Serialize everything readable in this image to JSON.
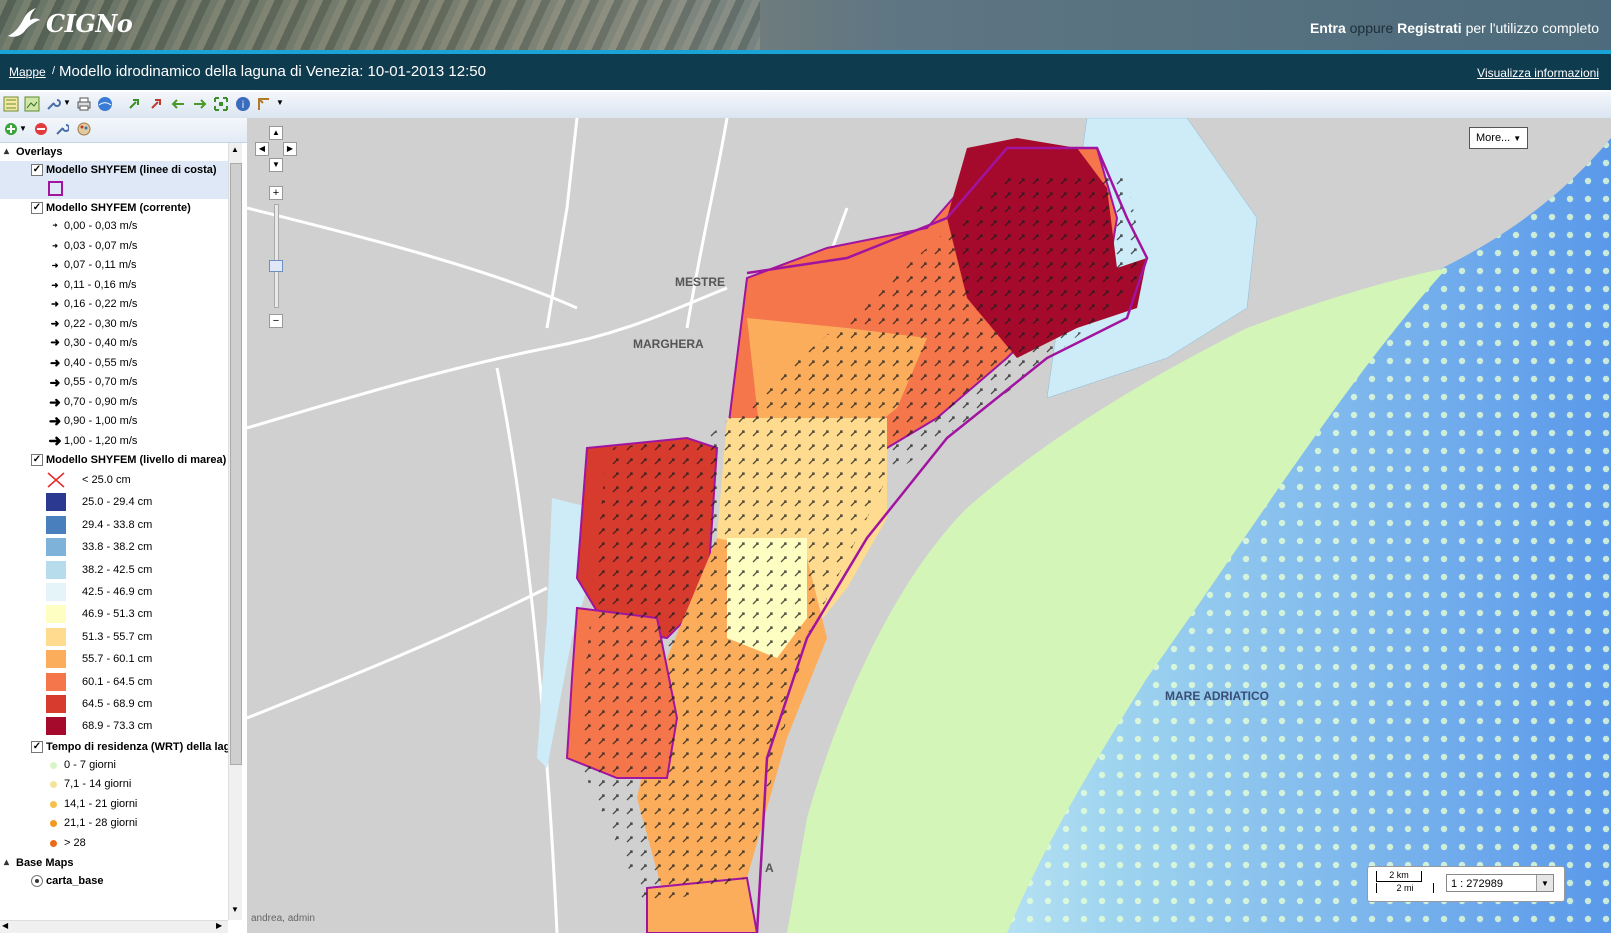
{
  "header": {
    "logo_text": "CIGNo",
    "login_label": "Entra",
    "or_label": "oppure",
    "register_label": "Registrati",
    "suffix": "per l'utilizzo completo"
  },
  "titlebar": {
    "breadcrumb": "Mappe",
    "separator": "/",
    "title": "Modello idrodinamico della laguna di Venezia: 10-01-2013 12:50",
    "info_link": "Visualizza informazioni"
  },
  "tree": {
    "overlays_label": "Overlays",
    "layer_coast": "Modello SHYFEM (linee di costa)",
    "layer_current": "Modello SHYFEM (corrente)",
    "current_classes": [
      "0,00 - 0,03 m/s",
      "0,03 - 0,07 m/s",
      "0,07 - 0,11 m/s",
      "0,11 - 0,16 m/s",
      "0,16 - 0,22 m/s",
      "0,22 - 0,30 m/s",
      "0,30 - 0,40 m/s",
      "0,40 - 0,55 m/s",
      "0,55 - 0,70 m/s",
      "0,70 - 0,90 m/s",
      "0,90 - 1,00 m/s",
      "1,00 - 1,20 m/s"
    ],
    "layer_tide": "Modello SHYFEM (livello di marea)",
    "tide_classes": [
      {
        "label": "< 25.0 cm",
        "color": "none"
      },
      {
        "label": "25.0 - 29.4 cm",
        "color": "#2b3990"
      },
      {
        "label": "29.4 - 33.8 cm",
        "color": "#4a7fbd"
      },
      {
        "label": "33.8 - 38.2 cm",
        "color": "#7fb2d9"
      },
      {
        "label": "38.2 - 42.5 cm",
        "color": "#b7dcec"
      },
      {
        "label": "42.5 - 46.9 cm",
        "color": "#e4f4f8"
      },
      {
        "label": "46.9 - 51.3 cm",
        "color": "#fffec2"
      },
      {
        "label": "51.3 - 55.7 cm",
        "color": "#fedb8e"
      },
      {
        "label": "55.7 - 60.1 cm",
        "color": "#fcad5c"
      },
      {
        "label": "60.1 - 64.5 cm",
        "color": "#f4764a"
      },
      {
        "label": "64.5 - 68.9 cm",
        "color": "#d63b2e"
      },
      {
        "label": "68.9 - 73.3 cm",
        "color": "#a50a2c"
      }
    ],
    "layer_wrt": "Tempo di residenza (WRT) della laguna",
    "wrt_classes": [
      {
        "label": "0 - 7  giorni",
        "color": "#d9f5c5"
      },
      {
        "label": "7,1 - 14  giorni",
        "color": "#f3e39a"
      },
      {
        "label": "14,1 - 21  giorni",
        "color": "#f6c04a"
      },
      {
        "label": "21,1 - 28  giorni",
        "color": "#f39a1e"
      },
      {
        "label": "> 28",
        "color": "#e96a18"
      }
    ],
    "basemaps_label": "Base Maps",
    "basemap": "carta_base"
  },
  "map": {
    "more_button": "More...",
    "places": {
      "mestre": "MESTRE",
      "marghera": "MARGHERA",
      "sea": "MARE ADRIATICO",
      "a": "A"
    },
    "attribution": "andrea, admin",
    "scale_km": "2 km",
    "scale_mi": "2 mi",
    "scale_ratio": "1 : 272989"
  }
}
